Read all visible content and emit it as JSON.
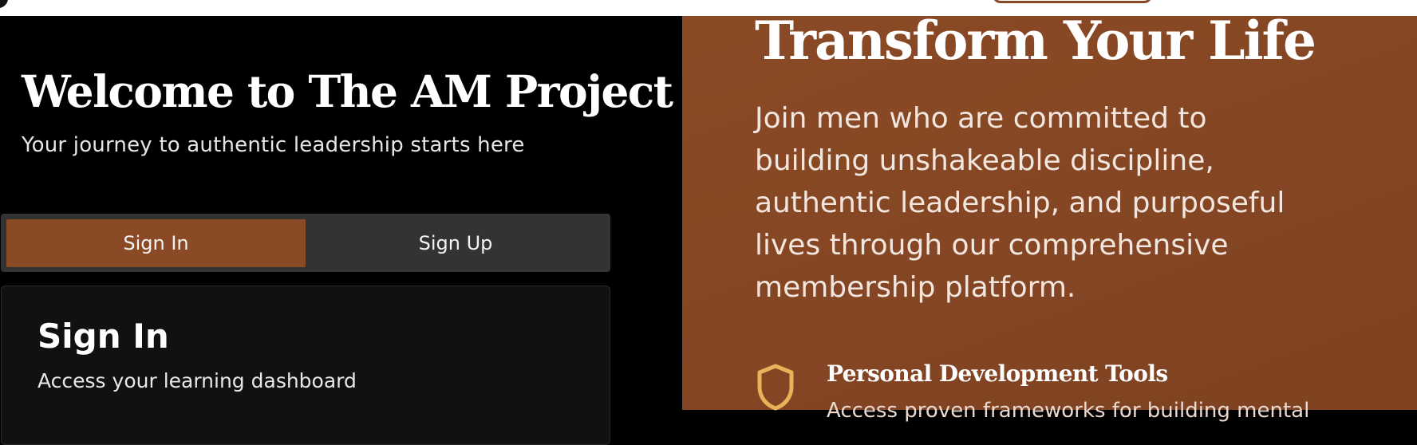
{
  "welcome": {
    "title": "Welcome to The AM Project",
    "subtitle": "Your journey to authentic leadership starts here"
  },
  "auth_tabs": {
    "signin_label": "Sign In",
    "signup_label": "Sign Up",
    "active": "Sign In"
  },
  "signin_card": {
    "title": "Sign In",
    "subtitle": "Access your learning dashboard"
  },
  "hero": {
    "title": "Transform Your Life",
    "body": "Join men who are committed to building unshakeable discipline, authentic leadership, and purposeful lives through our comprehensive membership platform."
  },
  "features": [
    {
      "icon": "shield-icon",
      "title": "Personal Development Tools",
      "desc": "Access proven frameworks for building mental"
    }
  ],
  "colors": {
    "accent": "#8b4a26",
    "icon_gold": "#e8b25a",
    "left_background": "#000000",
    "tab_bar": "#333333"
  }
}
